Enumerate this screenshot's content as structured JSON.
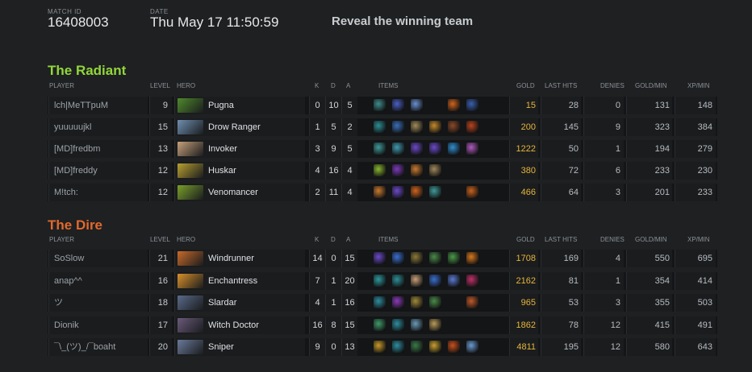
{
  "header": {
    "match_id_label": "MATCH ID",
    "match_id": "16408003",
    "date_label": "DATE",
    "date": "Thu May 17 11:50:59",
    "reveal_button": "Reveal the winning team"
  },
  "columns": {
    "player": "PLAYER",
    "level": "LEVEL",
    "hero": "HERO",
    "k": "K",
    "d": "D",
    "a": "A",
    "items": "ITEMS",
    "gold": "GOLD",
    "last_hits": "LAST HITS",
    "denies": "DENIES",
    "gold_min": "GOLD/MIN",
    "xp_min": "XP/MIN"
  },
  "radiant": {
    "title": "The Radiant",
    "color": "#92d73a",
    "players": [
      {
        "player": "lch|MeTTpuM",
        "level": "9",
        "hero": "Pugna",
        "hero_icon": "pugna-portrait",
        "hero_color": "#4f8a2c",
        "k": "0",
        "d": "10",
        "a": "5",
        "items": [
          "#3f8c8c",
          "#4a5fc4",
          "#6a8fd0",
          "#000000",
          "#d0641e",
          "#3a5fb0"
        ],
        "gold": "15",
        "last_hits": "28",
        "denies": "0",
        "gpm": "131",
        "xpm": "148"
      },
      {
        "player": "yuuuuujkl",
        "level": "15",
        "hero": "Drow Ranger",
        "hero_icon": "drow-ranger-portrait",
        "hero_color": "#6f8fb0",
        "k": "1",
        "d": "5",
        "a": "2",
        "items": [
          "#2d8e96",
          "#3a6fb8",
          "#a08a5a",
          "#c28a2c",
          "#8a4a2a",
          "#b8441e"
        ],
        "gold": "200",
        "last_hits": "145",
        "denies": "9",
        "gpm": "323",
        "xpm": "384"
      },
      {
        "player": "[MD]fredbm",
        "level": "13",
        "hero": "Invoker",
        "hero_icon": "invoker-portrait",
        "hero_color": "#c7a07a",
        "k": "3",
        "d": "9",
        "a": "5",
        "items": [
          "#3f9a9a",
          "#3f9ab0",
          "#6a4ac8",
          "#6a4ac8",
          "#2f8ed0",
          "#b05ac0"
        ],
        "gold": "1222",
        "last_hits": "50",
        "denies": "1",
        "gpm": "194",
        "xpm": "279"
      },
      {
        "player": "[MD]freddy",
        "level": "12",
        "hero": "Huskar",
        "hero_icon": "huskar-portrait",
        "hero_color": "#b8a030",
        "k": "4",
        "d": "16",
        "a": "4",
        "items": [
          "#8ab830",
          "#7a3ab8",
          "#c87a30",
          "#a0885a",
          "#000000",
          "#000000"
        ],
        "gold": "380",
        "last_hits": "72",
        "denies": "6",
        "gpm": "233",
        "xpm": "230"
      },
      {
        "player": "M!tch:",
        "level": "12",
        "hero": "Venomancer",
        "hero_icon": "venomancer-portrait",
        "hero_color": "#7aa02a",
        "k": "2",
        "d": "11",
        "a": "4",
        "items": [
          "#c87a30",
          "#6a4ac8",
          "#d0641e",
          "#3f9a9a",
          "#000000",
          "#c8621e"
        ],
        "gold": "466",
        "last_hits": "64",
        "denies": "3",
        "gpm": "201",
        "xpm": "233"
      }
    ]
  },
  "dire": {
    "title": "The Dire",
    "color": "#e3682c",
    "players": [
      {
        "player": "SoSlow",
        "level": "21",
        "hero": "Windrunner",
        "hero_icon": "windrunner-portrait",
        "hero_color": "#c86a2a",
        "k": "14",
        "d": "0",
        "a": "15",
        "items": [
          "#6a4ac8",
          "#3a6fd0",
          "#8a7a3a",
          "#4a8a4a",
          "#4a9a4a",
          "#d8781e"
        ],
        "gold": "1708",
        "last_hits": "169",
        "denies": "4",
        "gpm": "550",
        "xpm": "695"
      },
      {
        "player": "anap^^",
        "level": "16",
        "hero": "Enchantress",
        "hero_icon": "enchantress-portrait",
        "hero_color": "#d8902a",
        "k": "7",
        "d": "1",
        "a": "20",
        "items": [
          "#2d9aa0",
          "#2d8e96",
          "#c8a07a",
          "#3a6fd0",
          "#5a7ad0",
          "#c0306a"
        ],
        "gold": "2162",
        "last_hits": "81",
        "denies": "1",
        "gpm": "354",
        "xpm": "414"
      },
      {
        "player": "ツ",
        "level": "18",
        "hero": "Slardar",
        "hero_icon": "slardar-portrait",
        "hero_color": "#5a6a8a",
        "k": "4",
        "d": "1",
        "a": "16",
        "items": [
          "#2d8ea0",
          "#8a3ab8",
          "#a08a3a",
          "#4a8a4a",
          "#000000",
          "#c05a2a"
        ],
        "gold": "965",
        "last_hits": "53",
        "denies": "3",
        "gpm": "355",
        "xpm": "503"
      },
      {
        "player": "Dionik",
        "level": "17",
        "hero": "Witch Doctor",
        "hero_icon": "witch-doctor-portrait",
        "hero_color": "#6a5a7a",
        "k": "16",
        "d": "8",
        "a": "15",
        "items": [
          "#3f9a6a",
          "#2d8ea0",
          "#6a9ab8",
          "#b89a5a",
          "#000000",
          "#000000"
        ],
        "gold": "1862",
        "last_hits": "78",
        "denies": "12",
        "gpm": "415",
        "xpm": "491"
      },
      {
        "player": "¯\\_(ツ)_/¯boaht",
        "level": "20",
        "hero": "Sniper",
        "hero_icon": "sniper-portrait",
        "hero_color": "#6a7a9a",
        "k": "9",
        "d": "0",
        "a": "13",
        "items": [
          "#c89a2a",
          "#2d8ea0",
          "#3a7a4a",
          "#c8a030",
          "#c8501e",
          "#6a9ad0"
        ],
        "gold": "4811",
        "last_hits": "195",
        "denies": "12",
        "gpm": "580",
        "xpm": "643"
      }
    ]
  }
}
